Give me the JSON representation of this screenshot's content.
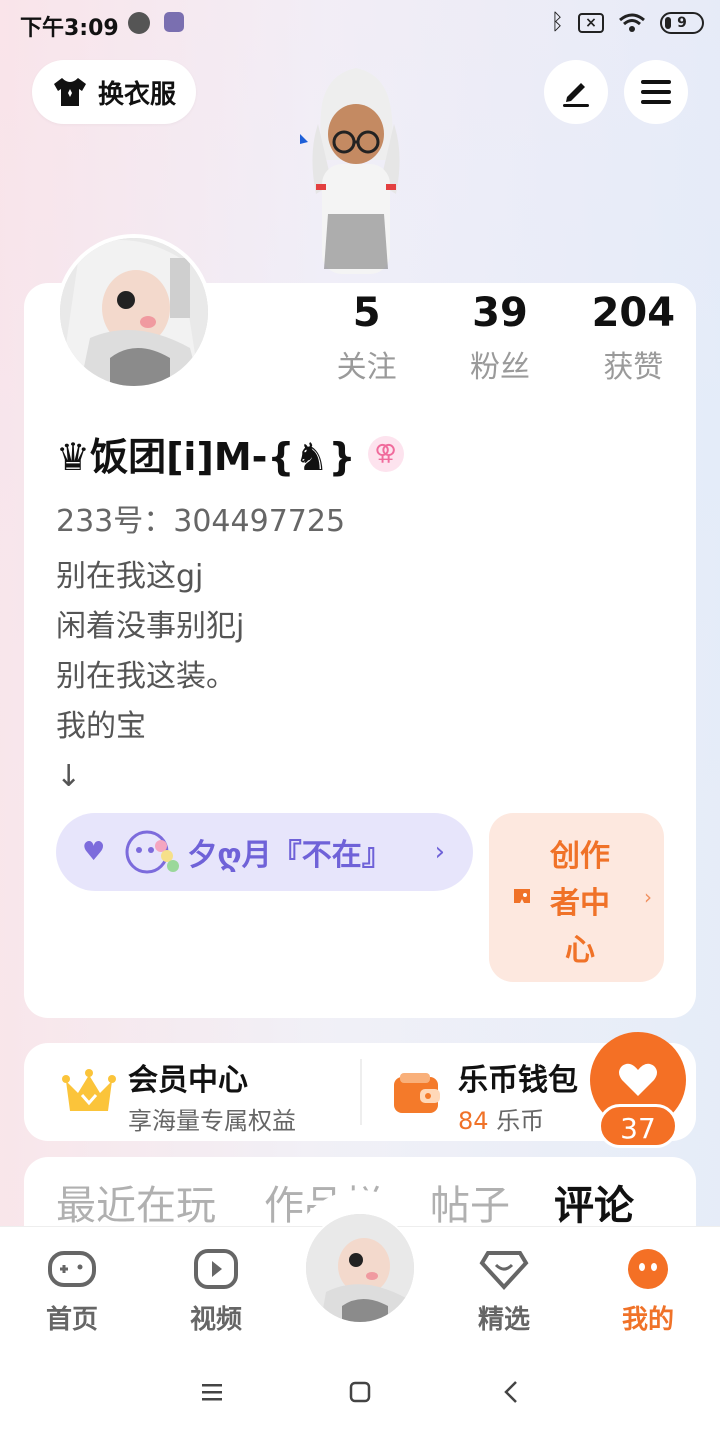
{
  "status_bar": {
    "time": "下午3:09",
    "battery": "9"
  },
  "header": {
    "outfit_label": "换衣服",
    "edit_icon": "edit-icon",
    "menu_icon": "menu-icon"
  },
  "profile": {
    "stats": [
      {
        "value": "5",
        "label": "关注"
      },
      {
        "value": "39",
        "label": "粉丝"
      },
      {
        "value": "204",
        "label": "获赞"
      }
    ],
    "username": "♛饭团[i]M-{♞}",
    "gender_symbol": "⚢",
    "uid": "233号：304497725",
    "bio": [
      "别在我这gj",
      "闲着没事别犯j",
      "别在我这装。",
      "我的宝",
      "↓"
    ],
    "group_name": "夕ღ月『不在』",
    "creator_label": "创作者中心"
  },
  "services": {
    "vip_title": "会员中心",
    "vip_sub": "享海量专属权益",
    "wallet_title": "乐币钱包",
    "wallet_amount": "84",
    "wallet_unit": "乐币"
  },
  "like": {
    "count": "37"
  },
  "tabs": [
    {
      "label": "最近在玩",
      "active": false
    },
    {
      "label": "作品栏",
      "active": false
    },
    {
      "label": "帖子",
      "active": false
    },
    {
      "label": "评论",
      "active": true
    }
  ],
  "bottom_nav": [
    {
      "label": "首页",
      "icon": "gamepad-icon",
      "active": false
    },
    {
      "label": "视频",
      "icon": "video-play-icon",
      "active": false
    },
    {
      "label": "精选",
      "icon": "heart-shield-icon",
      "active": false
    },
    {
      "label": "我的",
      "icon": "face-icon",
      "active": true
    }
  ],
  "colors": {
    "accent": "#f07228",
    "purple": "#6f62d8"
  }
}
